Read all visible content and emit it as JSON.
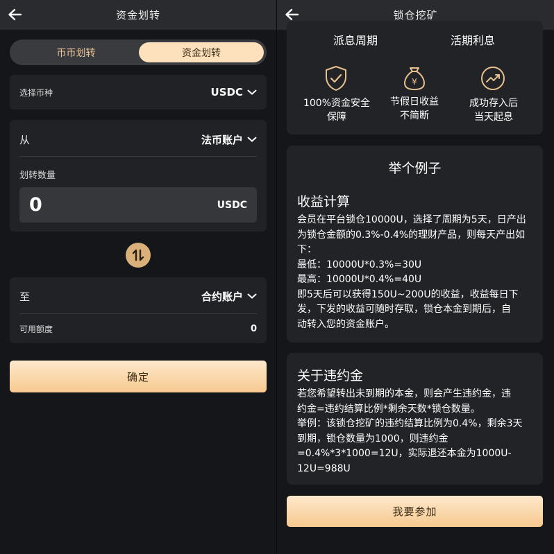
{
  "left": {
    "title": "资金划转",
    "tabs": [
      "币币划转",
      "资金划转"
    ],
    "coin": {
      "label": "选择币种",
      "value": "USDC"
    },
    "from": {
      "label": "从",
      "value": "法币账户"
    },
    "amount": {
      "label": "划转数量",
      "value": "0",
      "unit": "USDC"
    },
    "to": {
      "label": "至",
      "value": "合约账户"
    },
    "available": {
      "label": "可用额度",
      "value": "0"
    },
    "confirm": "确定"
  },
  "right": {
    "title": "锁仓挖矿",
    "features_top": [
      "派息周期",
      "活期利息"
    ],
    "features": [
      {
        "icon": "shield-check-icon",
        "lines": [
          "100%资金安全",
          "保障"
        ]
      },
      {
        "icon": "money-bag-icon",
        "lines": [
          "节假日收益",
          "不简断"
        ]
      },
      {
        "icon": "trend-up-icon",
        "lines": [
          "成功存入后",
          "当天起息"
        ]
      }
    ],
    "example": {
      "title": "举个例子",
      "subtitle": "收益计算",
      "lines": [
        "会员在平台锁仓10000U，选择了周期为5天，日产出",
        "为锁仓金额的0.3%-0.4%的理财产品，则每天产出如",
        "下：",
        "最低：10000U*0.3%=30U",
        "最高：10000U*0.4%=40U",
        "即5天后可以获得150U~200U的收益，收益每日下",
        "发，下发的收益可随时存取，锁仓本金到期后，自",
        "动转入您的资金账户。"
      ]
    },
    "penalty": {
      "title": "关于违约金",
      "lines": [
        "若您希望转出未到期的本金，则会产生违约金，违",
        "约金=违约结算比例*剩余天数*锁仓数量。",
        "举例：该锁仓挖矿的违约结算比例为0.4%，剩余3天",
        "到期，锁仓数量为1000，则违约金",
        "=0.4%*3*1000=12U，实际退还本金为1000U-",
        "12U=988U"
      ]
    },
    "join": "我要参加"
  },
  "colors": {
    "accent": "#f7c98f",
    "card": "#212226",
    "background": "#151619"
  }
}
